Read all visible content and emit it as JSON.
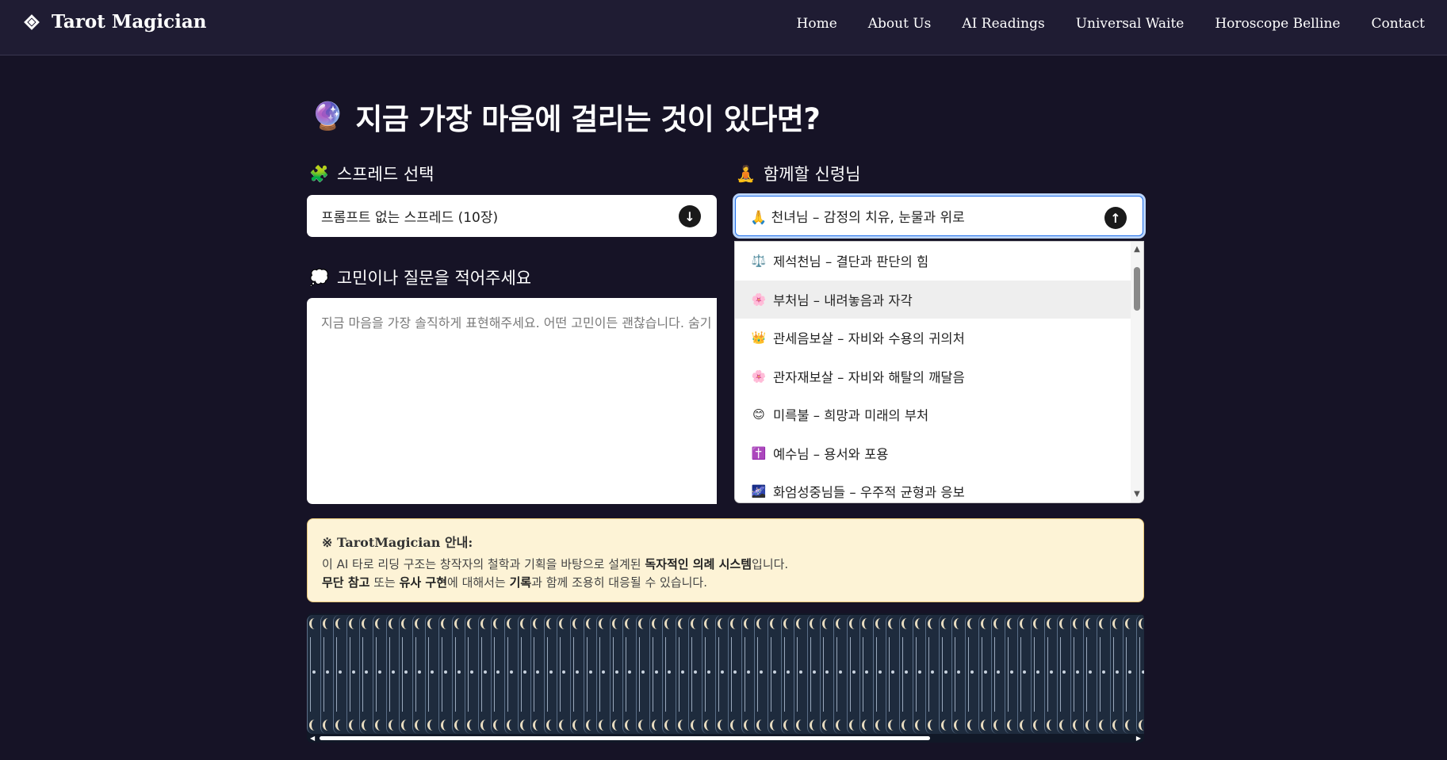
{
  "nav": {
    "brand": "Tarot Magician",
    "links": [
      "Home",
      "About Us",
      "AI Readings",
      "Universal Waite",
      "Horoscope Belline",
      "Contact"
    ]
  },
  "headline": {
    "emoji": "🔮",
    "text": "지금 가장 마음에 걸리는 것이 있다면?"
  },
  "spread": {
    "emoji": "🧩",
    "label": "스프레드 선택",
    "value": "프롬프트 없는 스프레드 (10장)"
  },
  "deity": {
    "emoji": "🧘",
    "label": "함께할 신령님",
    "value": "천녀님 – 감정의 치유, 눈물과 위로",
    "value_emoji": "🙏",
    "options": [
      {
        "emoji": "⚖️",
        "label": "제석천님 – 결단과 판단의 힘"
      },
      {
        "emoji": "🌸",
        "label": "부처님 – 내려놓음과 자각"
      },
      {
        "emoji": "👑",
        "label": "관세음보살 – 자비와 수용의 귀의처"
      },
      {
        "emoji": "🌸",
        "label": "관자재보살 – 자비와 해탈의 깨달음"
      },
      {
        "emoji": "😊",
        "label": "미륵불 – 희망과 미래의 부처"
      },
      {
        "emoji": "✝️",
        "label": "예수님 – 용서와 포용"
      },
      {
        "emoji": "🌌",
        "label": "화엄성중님들 – 우주적 균형과 응보"
      }
    ],
    "hovered_index": 1
  },
  "question": {
    "emoji": "💭",
    "label": "고민이나 질문을 적어주세요",
    "placeholder": "지금 마음을 가장 솔직하게 표현해주세요. 어떤 고민이든 괜찮습니다. 숨기"
  },
  "notice": {
    "title": "※ TarotMagician 안내:",
    "line1_a": "이 AI 타로 리딩 구조는 창작자의 철학과 기획을 바탕으로 설계된 ",
    "line1_b": "독자적인 의례 시스템",
    "line1_c": "입니다.",
    "line2_a": "무단 참고",
    "line2_b": " 또는 ",
    "line2_c": "유사 구현",
    "line2_d": "에 대해서는 ",
    "line2_e": "기록",
    "line2_f": "과 함께 조용히 대응될 수 있습니다."
  },
  "deck": {
    "card_count": 78
  },
  "colors": {
    "background": "#161326",
    "navbar": "#1f1c33",
    "notice_bg": "#fdf3d6",
    "deck_bg": "#111827"
  }
}
